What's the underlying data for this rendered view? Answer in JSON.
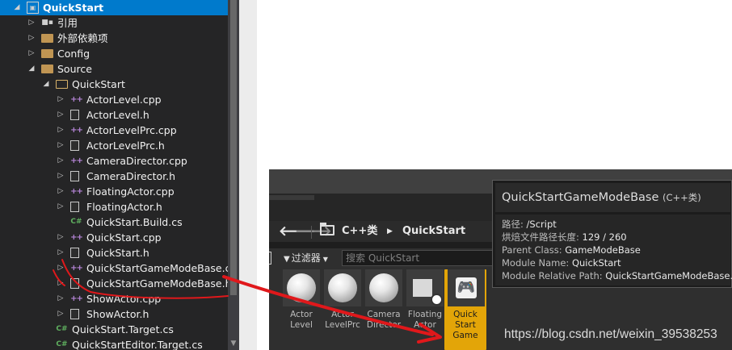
{
  "solution_explorer": {
    "rows": [
      {
        "label": "QuickStart",
        "icon": "solution-icon",
        "expander": "open",
        "indent": 0,
        "selected": true
      },
      {
        "label": "引用",
        "icon": "references-icon",
        "expander": "closed",
        "indent": 1
      },
      {
        "label": "外部依赖项",
        "icon": "external-deps-icon",
        "expander": "closed",
        "indent": 1
      },
      {
        "label": "Config",
        "icon": "folder-icon",
        "expander": "closed",
        "indent": 1
      },
      {
        "label": "Source",
        "icon": "folder-icon",
        "expander": "open",
        "indent": 1
      },
      {
        "label": "QuickStart",
        "icon": "filter-folder-icon",
        "expander": "open",
        "indent": 2
      },
      {
        "label": "ActorLevel.cpp",
        "icon": "cpp-file-icon",
        "expander": "closed",
        "indent": 3
      },
      {
        "label": "ActorLevel.h",
        "icon": "header-file-icon",
        "expander": "closed",
        "indent": 3
      },
      {
        "label": "ActorLevelPrc.cpp",
        "icon": "cpp-file-icon",
        "expander": "closed",
        "indent": 3
      },
      {
        "label": "ActorLevelPrc.h",
        "icon": "header-file-icon",
        "expander": "closed",
        "indent": 3
      },
      {
        "label": "CameraDirector.cpp",
        "icon": "cpp-file-icon",
        "expander": "closed",
        "indent": 3
      },
      {
        "label": "CameraDirector.h",
        "icon": "header-file-icon",
        "expander": "closed",
        "indent": 3
      },
      {
        "label": "FloatingActor.cpp",
        "icon": "cpp-file-icon",
        "expander": "closed",
        "indent": 3
      },
      {
        "label": "FloatingActor.h",
        "icon": "header-file-icon",
        "expander": "closed",
        "indent": 3
      },
      {
        "label": "QuickStart.Build.cs",
        "icon": "csharp-file-icon",
        "expander": "none",
        "indent": 3
      },
      {
        "label": "QuickStart.cpp",
        "icon": "cpp-file-icon",
        "expander": "closed",
        "indent": 3
      },
      {
        "label": "QuickStart.h",
        "icon": "header-file-icon",
        "expander": "closed",
        "indent": 3
      },
      {
        "label": "QuickStartGameModeBase.cpp",
        "icon": "cpp-file-icon",
        "expander": "closed",
        "indent": 3
      },
      {
        "label": "QuickStartGameModeBase.h",
        "icon": "header-file-icon",
        "expander": "closed",
        "indent": 3
      },
      {
        "label": "ShowActor.cpp",
        "icon": "cpp-file-icon",
        "expander": "closed",
        "indent": 3
      },
      {
        "label": "ShowActor.h",
        "icon": "header-file-icon",
        "expander": "closed",
        "indent": 3
      },
      {
        "label": "QuickStart.Target.cs",
        "icon": "csharp-file-icon",
        "expander": "none",
        "indent": 2
      },
      {
        "label": "QuickStartEditor.Target.cs",
        "icon": "csharp-file-icon",
        "expander": "none",
        "indent": 2
      }
    ]
  },
  "content_browser": {
    "back_glyph": "🡐",
    "forward_glyph": "🡒",
    "breadcrumb": [
      "C++类",
      "QuickStart"
    ],
    "breadcrumb_arrow": "▶",
    "filter_label": "过滤器",
    "filter_dropdown_glyph": "▼",
    "search_placeholder": "搜索 QuickStart",
    "assets": [
      {
        "name": "Actor\nLevel",
        "thumb": "sphere"
      },
      {
        "name": "Actor\nLevelPrc",
        "thumb": "sphere"
      },
      {
        "name": "Camera\nDirector",
        "thumb": "sphere"
      },
      {
        "name": "Floating\nActor",
        "thumb": "cube"
      },
      {
        "name": "Quick\nStart\nGame",
        "thumb": "gamepad",
        "selected": true
      }
    ]
  },
  "tooltip": {
    "title": "QuickStartGameModeBase",
    "title_suffix": "(C++类)",
    "lines": [
      {
        "key": "路径: ",
        "value": "/Script"
      },
      {
        "key": "烘焙文件路径长度: ",
        "value": "129 / 260"
      },
      {
        "key": "Parent Class: ",
        "value": "GameModeBase"
      },
      {
        "key": "Module Name: ",
        "value": "QuickStart"
      },
      {
        "key": "Module Relative Path: ",
        "value": "QuickStartGameModeBase.h"
      }
    ]
  },
  "watermark": "https://blog.csdn.net/weixin_39538253",
  "colors": {
    "selection": "#007acc",
    "annotation": "#e0181b",
    "selected_asset": "#e3a508"
  }
}
